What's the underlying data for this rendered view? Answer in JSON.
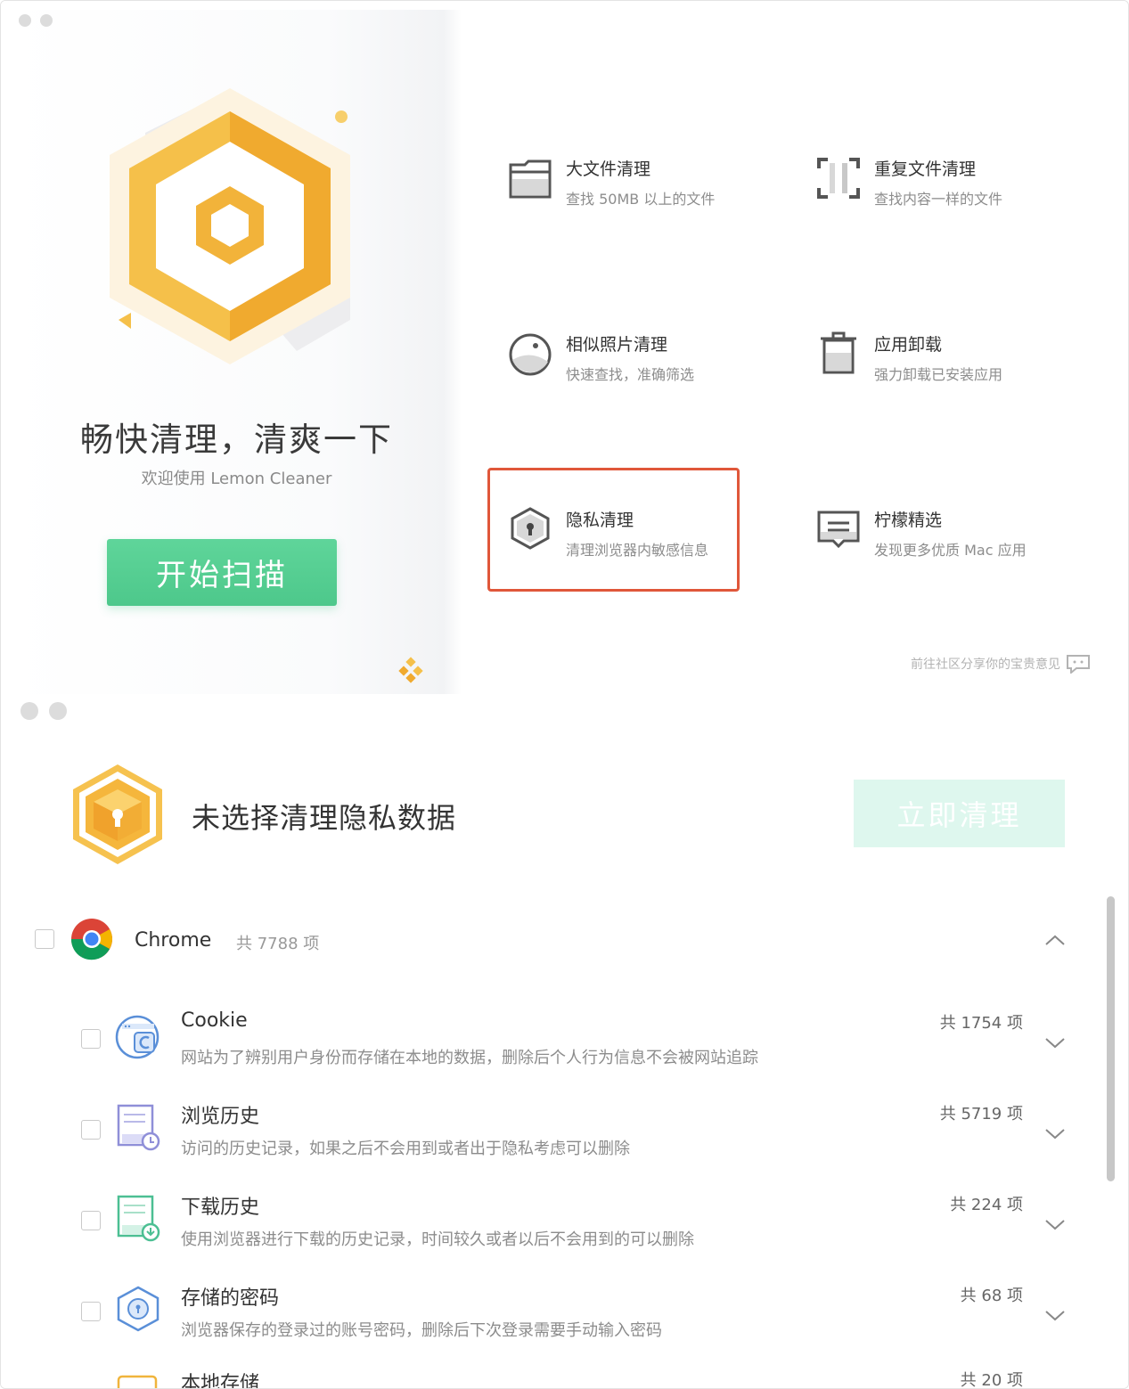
{
  "home": {
    "slogan": "畅快清理，清爽一下",
    "welcome": "欢迎使用 Lemon Cleaner",
    "scan_button": "开始扫描",
    "features": [
      {
        "title": "大文件清理",
        "subtitle": "查找 50MB 以上的文件",
        "icon": "folder-icon"
      },
      {
        "title": "重复文件清理",
        "subtitle": "查找内容一样的文件",
        "icon": "duplicate-frame-icon"
      },
      {
        "title": "相似照片清理",
        "subtitle": "快速查找，准确筛选",
        "icon": "photo-icon"
      },
      {
        "title": "应用卸载",
        "subtitle": "强力卸载已安装应用",
        "icon": "trash-icon"
      },
      {
        "title": "隐私清理",
        "subtitle": "清理浏览器内敏感信息",
        "icon": "privacy-shield-icon"
      },
      {
        "title": "柠檬精选",
        "subtitle": "发现更多优质 Mac 应用",
        "icon": "message-board-icon"
      }
    ],
    "community_link": "前往社区分享你的宝贵意见",
    "highlight_color": "#e0573a",
    "accent_green": "#4dc88b"
  },
  "privacy": {
    "status_title": "未选择清理隐私数据",
    "clean_button": "立即清理",
    "browser": {
      "name": "Chrome",
      "count": "共 7788 项"
    },
    "items": [
      {
        "title": "Cookie",
        "desc": "网站为了辨别用户身份而存储在本地的数据，删除后个人行为信息不会被网站追踪",
        "count": "共 1754 项",
        "icon": "cookie-icon"
      },
      {
        "title": "浏览历史",
        "desc": "访问的历史记录，如果之后不会用到或者出于隐私考虑可以删除",
        "count": "共 5719 项",
        "icon": "history-icon"
      },
      {
        "title": "下载历史",
        "desc": "使用浏览器进行下载的历史记录，时间较久或者以后不会用到的可以删除",
        "count": "共 224 项",
        "icon": "download-history-icon"
      },
      {
        "title": "存储的密码",
        "desc": "浏览器保存的登录过的账号密码，删除后下次登录需要手动输入密码",
        "count": "共 68 项",
        "icon": "password-icon"
      },
      {
        "title": "本地存储",
        "desc": "",
        "count": "共 20 项",
        "icon": "local-storage-icon"
      }
    ]
  }
}
